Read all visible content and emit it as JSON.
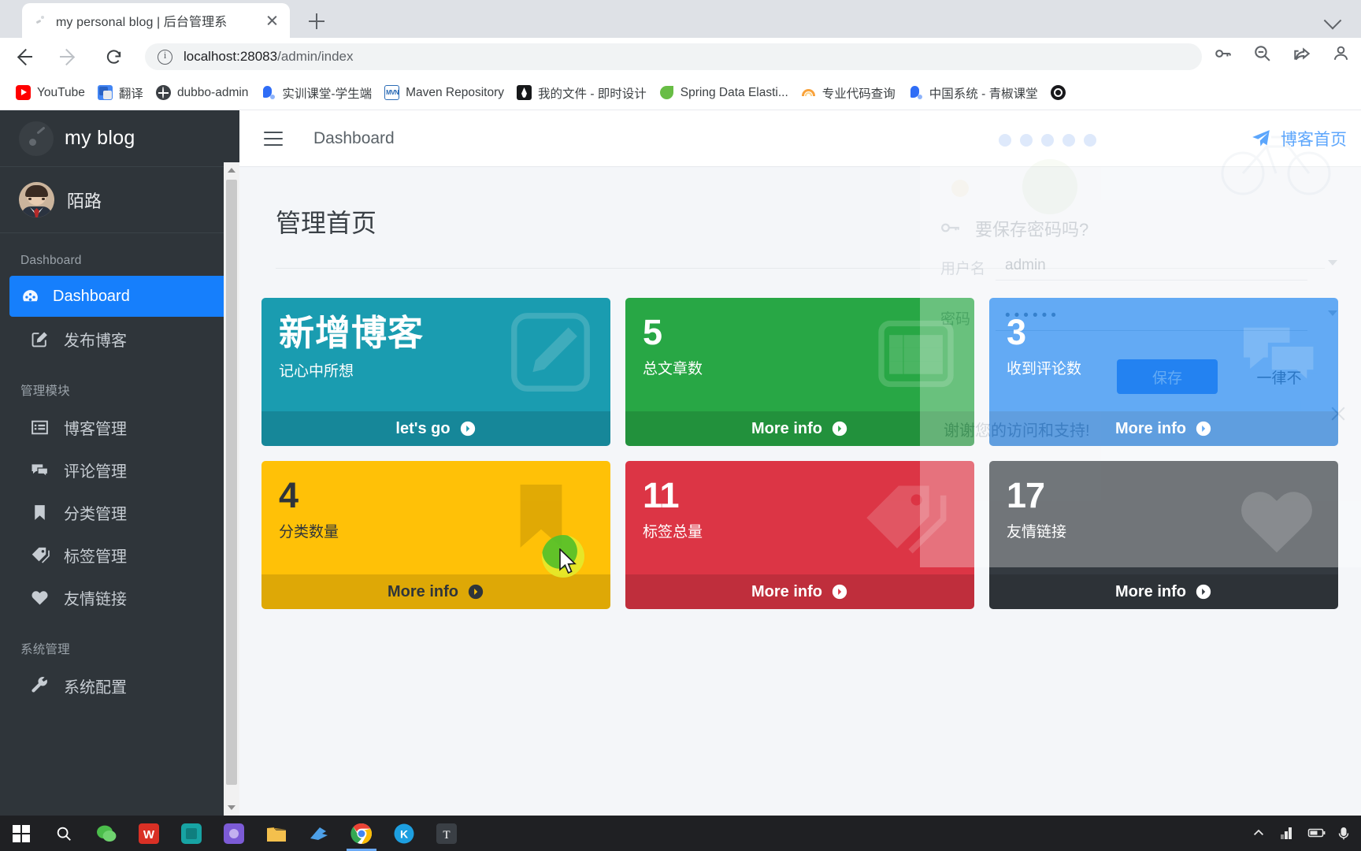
{
  "browser": {
    "tab_title": "my personal blog | 后台管理系",
    "url_host": "localhost:28083",
    "url_path": "/admin/index",
    "bookmarks": [
      {
        "label": "YouTube",
        "icon": "youtube-icon"
      },
      {
        "label": "翻译",
        "icon": "translate-icon"
      },
      {
        "label": "dubbo-admin",
        "icon": "globe-icon"
      },
      {
        "label": "实训课堂-学生端",
        "icon": "classroom-icon"
      },
      {
        "label": "Maven Repository",
        "icon": "maven-icon"
      },
      {
        "label": "我的文件 - 即时设计",
        "icon": "jishi-icon"
      },
      {
        "label": "Spring Data Elasti...",
        "icon": "spring-icon"
      },
      {
        "label": "专业代码查询",
        "icon": "rainbow-icon"
      },
      {
        "label": "中国系统 - 青椒课堂",
        "icon": "classroom-icon"
      },
      {
        "label": "",
        "icon": "github-icon"
      }
    ]
  },
  "sidebar": {
    "brand": "my blog",
    "username": "陌路",
    "sections": [
      {
        "title": "Dashboard",
        "items": [
          {
            "label": "Dashboard",
            "icon": "dashboard-icon",
            "active": true
          },
          {
            "label": "发布博客",
            "icon": "edit-square-icon",
            "active": false
          }
        ]
      },
      {
        "title": "管理模块",
        "items": [
          {
            "label": "博客管理",
            "icon": "list-alt-icon",
            "active": false
          },
          {
            "label": "评论管理",
            "icon": "comments-icon",
            "active": false
          },
          {
            "label": "分类管理",
            "icon": "bookmark-icon",
            "active": false
          },
          {
            "label": "标签管理",
            "icon": "tag-icon",
            "active": false
          },
          {
            "label": "友情链接",
            "icon": "heart-icon",
            "active": false
          }
        ]
      },
      {
        "title": "系统管理",
        "items": [
          {
            "label": "系统配置",
            "icon": "wrench-icon",
            "active": false
          }
        ]
      }
    ]
  },
  "header": {
    "breadcrumb": "Dashboard",
    "blog_home_link": "博客首页"
  },
  "main": {
    "page_title": "管理首页",
    "cards": [
      {
        "id": "new-blog",
        "hero": "新增博客",
        "number": "",
        "sub": "记心中所想",
        "footer": "let's go",
        "color": "#1a9cb0",
        "footer_color": "rgba(0,0,0,0.13)",
        "text_color": "#ffffff",
        "icon": "pencil-square-icon"
      },
      {
        "id": "total-articles",
        "hero": "",
        "number": "5",
        "sub": "总文章数",
        "footer": "More info",
        "color": "#28a745",
        "footer_color": "rgba(0,0,0,0.13)",
        "text_color": "#ffffff",
        "icon": "list-alt-icon"
      },
      {
        "id": "comments-received",
        "hero": "",
        "number": "3",
        "sub": "收到评论数",
        "footer": "More info",
        "color": "#1f86f0",
        "footer_color": "rgba(0,0,0,0.13)",
        "text_color": "#ffffff",
        "icon": "comments-icon"
      },
      {
        "id": "category-count",
        "hero": "",
        "number": "4",
        "sub": "分类数量",
        "footer": "More info",
        "color": "#ffc107",
        "footer_color": "rgba(0,0,0,0.13)",
        "text_color": "#2f353a",
        "icon": "bookmark-icon"
      },
      {
        "id": "tag-total",
        "hero": "",
        "number": "11",
        "sub": "标签总量",
        "footer": "More info",
        "color": "#dc3545",
        "footer_color": "rgba(0,0,0,0.13)",
        "text_color": "#ffffff",
        "icon": "tag-icon"
      },
      {
        "id": "friend-links",
        "hero": "",
        "number": "17",
        "sub": "友情链接",
        "footer": "More info",
        "color": "#343a40",
        "footer_color": "rgba(0,0,0,0.13)",
        "text_color": "#ffffff",
        "icon": "heart-icon"
      }
    ]
  },
  "overlay": {
    "question": "要保存密码吗?",
    "username_label": "用户名",
    "username_value": "admin",
    "password_label": "密码",
    "save_label": "保存",
    "never_label": "一律不",
    "page_text": "谢谢您的访问和支持!"
  },
  "taskbar": {
    "items": [
      {
        "icon": "windows-start-icon",
        "active": false
      },
      {
        "icon": "search-icon",
        "active": false
      },
      {
        "icon": "wechat-icon",
        "active": false
      },
      {
        "icon": "wps-icon",
        "active": false
      },
      {
        "icon": "app-teal-icon",
        "active": false
      },
      {
        "icon": "app-purple-icon",
        "active": false
      },
      {
        "icon": "folder-icon",
        "active": false
      },
      {
        "icon": "bird-icon",
        "active": false
      },
      {
        "icon": "chrome-icon",
        "active": true
      },
      {
        "icon": "kugou-icon",
        "active": false
      },
      {
        "icon": "typora-icon",
        "active": false
      }
    ],
    "tray": [
      "chevron-up-icon",
      "network-icon",
      "battery-icon",
      "volume-icon"
    ]
  }
}
